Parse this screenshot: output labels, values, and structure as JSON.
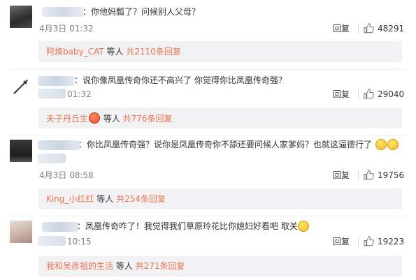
{
  "comments": [
    {
      "text": "：你他妈瓢了？问候别人父母？",
      "time": "4月3日 01:32",
      "reply_label": "回复",
      "likes": "48291",
      "replies": {
        "name": "阿焕baby_CAT",
        "middle": " 等人 ",
        "total": "共2110条回复"
      }
    },
    {
      "text": "：说你像凤凰传奇你还不高兴了 你觉得你比凤凰传奇强？",
      "time": "01:32",
      "reply_label": "回复",
      "likes": "29040",
      "replies": {
        "name": "夫子丹丘生",
        "middle": " 等人 ",
        "total": "共776条回复"
      }
    },
    {
      "text": "：你比凤凰传奇强？说你是凤凰传奇你不舔还要问候人家爹妈？也就这逼德行了",
      "time": "4月3日 08:58",
      "reply_label": "回复",
      "likes": "19756",
      "replies": {
        "name": "King_小红红",
        "middle": " 等人 ",
        "total": "共254条回复"
      }
    },
    {
      "text": "：凤凰传奇咋了！我觉得我们草原玲花比你媳妇好看吧 取关",
      "time": "10:15",
      "reply_label": "回复",
      "likes": "19223",
      "replies": {
        "name": "我和吴彦祖的生活",
        "middle": " 等人 ",
        "total": "共271条回复"
      }
    }
  ],
  "icons": {
    "like": "thumbs-up-icon",
    "smile": "smile-emoji-icon",
    "heart_eyes": "heart-eyes-emoji-icon"
  },
  "colors": {
    "link": "#eb7350",
    "reply_bg": "#f2f2f5",
    "meta": "#808080"
  }
}
